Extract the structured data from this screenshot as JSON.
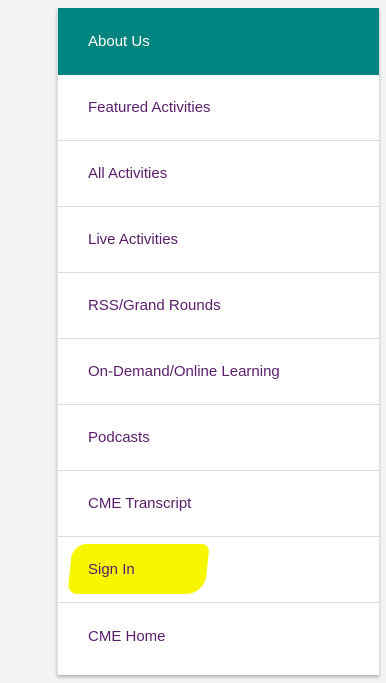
{
  "nav": {
    "items": [
      {
        "label": "About Us",
        "active": true
      },
      {
        "label": "Featured Activities"
      },
      {
        "label": "All Activities"
      },
      {
        "label": "Live Activities"
      },
      {
        "label": "RSS/Grand Rounds"
      },
      {
        "label": "On-Demand/Online Learning"
      },
      {
        "label": "Podcasts"
      },
      {
        "label": "CME Transcript"
      },
      {
        "label": "Sign In",
        "highlighted": true
      },
      {
        "label": "CME Home"
      }
    ]
  },
  "colors": {
    "active_bg": "#00847f",
    "link": "#5a1d69",
    "highlight": "#f7f700"
  }
}
